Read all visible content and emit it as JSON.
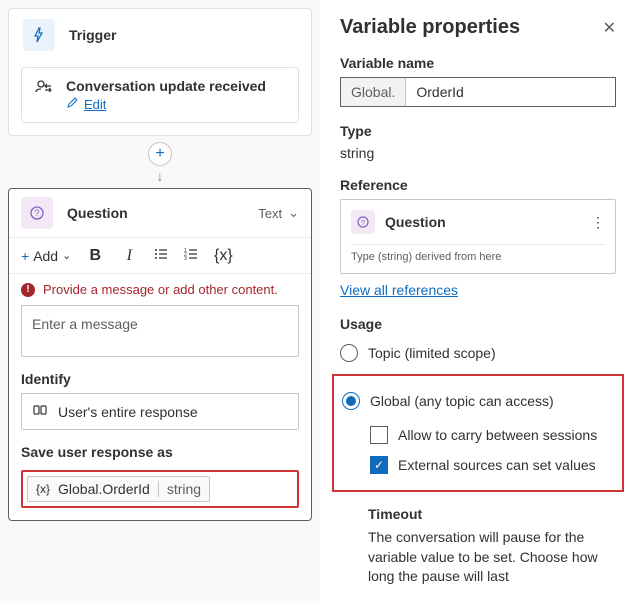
{
  "trigger": {
    "title": "Trigger",
    "body_title": "Conversation update received",
    "edit": "Edit"
  },
  "question": {
    "title": "Question",
    "mode": "Text",
    "add_label": "Add",
    "warning": "Provide a message or add other content.",
    "placeholder": "Enter a message",
    "identify_label": "Identify",
    "identify_value": "User's entire response",
    "save_label": "Save user response as",
    "var_name": "Global.OrderId",
    "var_type": "string"
  },
  "panel": {
    "title": "Variable properties",
    "name_label": "Variable name",
    "name_prefix": "Global.",
    "name_value": "OrderId",
    "type_label": "Type",
    "type_value": "string",
    "ref_label": "Reference",
    "ref_node": "Question",
    "ref_derived": "Type (string) derived from here",
    "view_refs": "View all references",
    "usage_label": "Usage",
    "scope_topic": "Topic (limited scope)",
    "scope_global": "Global (any topic can access)",
    "carry_sessions": "Allow to carry between sessions",
    "external_set": "External sources can set values",
    "timeout_label": "Timeout",
    "timeout_text": "The conversation will pause for the variable value to be set. Choose how long the pause will last"
  }
}
